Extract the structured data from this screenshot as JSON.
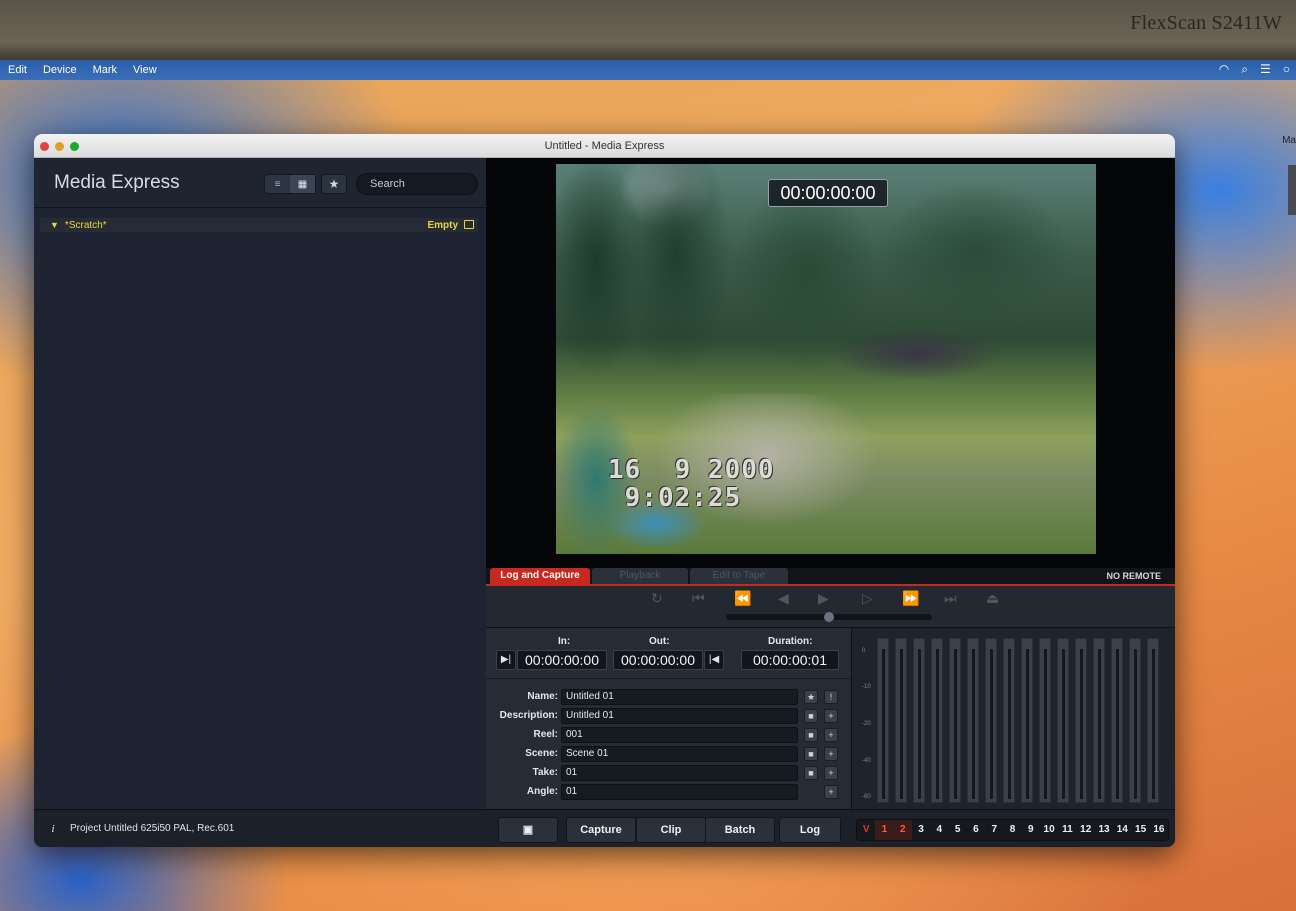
{
  "monitor": {
    "label": "FlexScan S2411W"
  },
  "menubar": {
    "items": [
      "Edit",
      "Device",
      "Mark",
      "View"
    ]
  },
  "desktop": {
    "side_text": "Ma"
  },
  "window": {
    "title": "Untitled - Media Express",
    "app_title": "Media Express",
    "search_placeholder": "Search",
    "bin": {
      "name": "*Scratch*",
      "status": "Empty"
    }
  },
  "video": {
    "timecode": "00:00:00:00",
    "burned_in_date": "16  9 2000",
    "burned_in_time": " 9:02:25"
  },
  "tabs": {
    "log_capture": "Log and Capture",
    "playback": "Playback",
    "edit_to_tape": "Edit to Tape",
    "remote_status": "NO REMOTE"
  },
  "log": {
    "in_label": "In:",
    "out_label": "Out:",
    "duration_label": "Duration:",
    "in_value": "00:00:00:00",
    "out_value": "00:00:00:00",
    "duration_value": "00:00:00:01",
    "fields": [
      {
        "label": "Name:",
        "value": "Untitled 01"
      },
      {
        "label": "Description:",
        "value": "Untitled 01"
      },
      {
        "label": "Reel:",
        "value": "001"
      },
      {
        "label": "Scene:",
        "value": "Scene 01"
      },
      {
        "label": "Take:",
        "value": "01"
      },
      {
        "label": "Angle:",
        "value": "01"
      }
    ]
  },
  "meters": {
    "scale": [
      "0",
      "-10",
      "-20",
      "-40",
      "-60"
    ]
  },
  "bottom": {
    "project": "Project Untitled  625i50 PAL, Rec.601",
    "capture": "Capture",
    "clip": "Clip",
    "batch": "Batch",
    "log": "Log",
    "channels": [
      "V",
      "1",
      "2",
      "3",
      "4",
      "5",
      "6",
      "7",
      "8",
      "9",
      "10",
      "11",
      "12",
      "13",
      "14",
      "15",
      "16"
    ]
  },
  "colors": {
    "accent": "#c7281f",
    "bin_text": "#e8d640"
  },
  "icons": [
    "wifi-icon",
    "search-icon",
    "control-center-icon",
    "list-view-icon",
    "grid-view-icon",
    "star-icon",
    "folder-icon",
    "camera-icon",
    "info-icon"
  ]
}
